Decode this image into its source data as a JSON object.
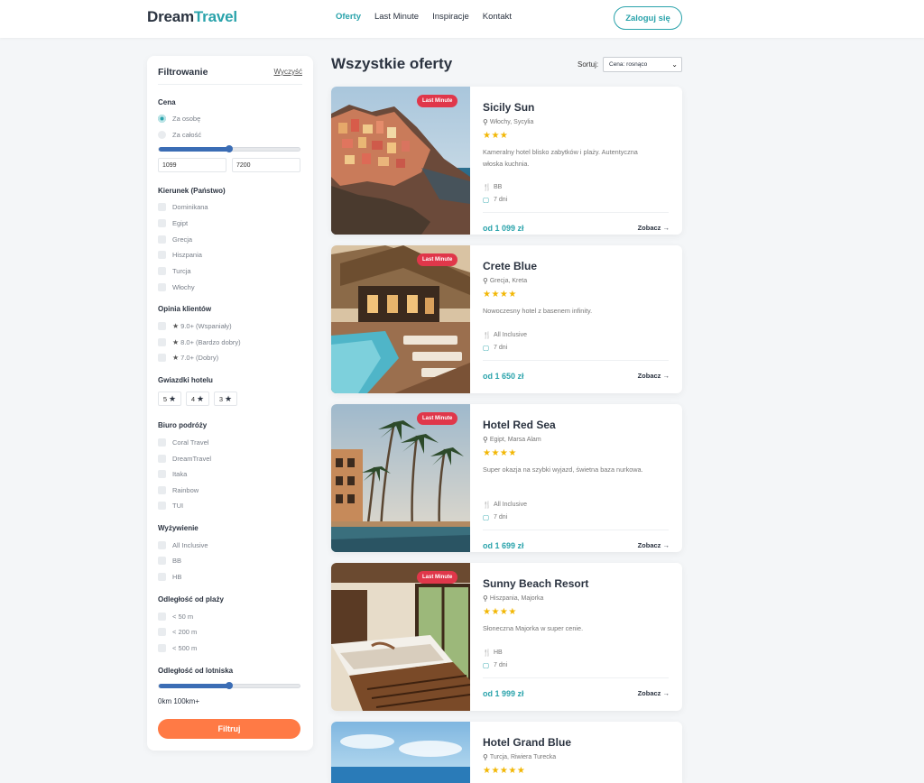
{
  "header": {
    "logo_part1": "Dream",
    "logo_part2": "Travel",
    "nav": [
      "Oferty",
      "Last Minute",
      "Inspiracje",
      "Kontakt"
    ],
    "login": "Zaloguj się"
  },
  "sidebar": {
    "title": "Filtrowanie",
    "clear": "Wyczyść",
    "price": {
      "title": "Cena",
      "options": [
        "Za osobę",
        "Za całość"
      ],
      "selected": "Za osobę",
      "min": "1099",
      "max": "7200",
      "slider_fraction": 0.5
    },
    "country": {
      "title": "Kierunek (Państwo)",
      "options": [
        "Dominikana",
        "Egipt",
        "Grecja",
        "Hiszpania",
        "Turcja",
        "Włochy"
      ]
    },
    "rating": {
      "title": "Opinia klientów",
      "options": [
        "9.0+ (Wspaniały)",
        "8.0+ (Bardzo dobry)",
        "7.0+ (Dobry)"
      ]
    },
    "hotel_stars": {
      "title": "Gwiazdki hotelu",
      "options": [
        "5",
        "4",
        "3"
      ]
    },
    "agency": {
      "title": "Biuro podróży",
      "options": [
        "Coral Travel",
        "DreamTravel",
        "Itaka",
        "Rainbow",
        "TUI"
      ]
    },
    "board": {
      "title": "Wyżywienie",
      "options": [
        "All Inclusive",
        "BB",
        "HB"
      ]
    },
    "beach": {
      "title": "Odległość od plaży",
      "options": [
        "< 50 m",
        "< 200 m",
        "< 500 m"
      ]
    },
    "airport": {
      "title": "Odległość od lotniska",
      "range_text": "0km 100km+",
      "slider_fraction": 0.5
    },
    "filter_button": "Filtruj"
  },
  "main": {
    "title": "Wszystkie oferty",
    "sort_label": "Sortuj:",
    "sort_value": "Cena: rosnąco"
  },
  "offers": [
    {
      "name": "Sicily Sun",
      "location": "Włochy, Sycylia",
      "stars": "★★★",
      "badge": "Last Minute",
      "desc": "Kameralny hotel blisko zabytków i plaży. Autentyczna włoska kuchnia.",
      "meal": "BB",
      "days": "7 dni",
      "price": "od 1 099 zł",
      "see": "Zobacz →"
    },
    {
      "name": "Crete Blue",
      "location": "Grecja, Kreta",
      "stars": "★★★★",
      "badge": "Last Minute",
      "desc": "Nowoczesny hotel z basenem infinity.",
      "meal": "All Inclusive",
      "days": "7 dni",
      "price": "od 1 650 zł",
      "see": "Zobacz →"
    },
    {
      "name": "Hotel Red Sea",
      "location": "Egipt, Marsa Alam",
      "stars": "★★★★",
      "badge": "Last Minute",
      "desc": "Super okazja na szybki wyjazd, świetna baza nurkowa.",
      "meal": "All Inclusive",
      "days": "7 dni",
      "price": "od 1 699 zł",
      "see": "Zobacz →"
    },
    {
      "name": "Sunny Beach Resort",
      "location": "Hiszpania, Majorka",
      "stars": "★★★★",
      "badge": "Last Minute",
      "desc": "Słoneczna Majorka w super cenie.",
      "meal": "HB",
      "days": "7 dni",
      "price": "od 1 999 zł",
      "see": "Zobacz →"
    },
    {
      "name": "Hotel Grand Blue",
      "location": "Turcja, Riwiera Turecka",
      "stars": "★★★★★",
      "badge": "",
      "desc": "",
      "meal": "",
      "days": "",
      "price": "",
      "see": ""
    }
  ]
}
